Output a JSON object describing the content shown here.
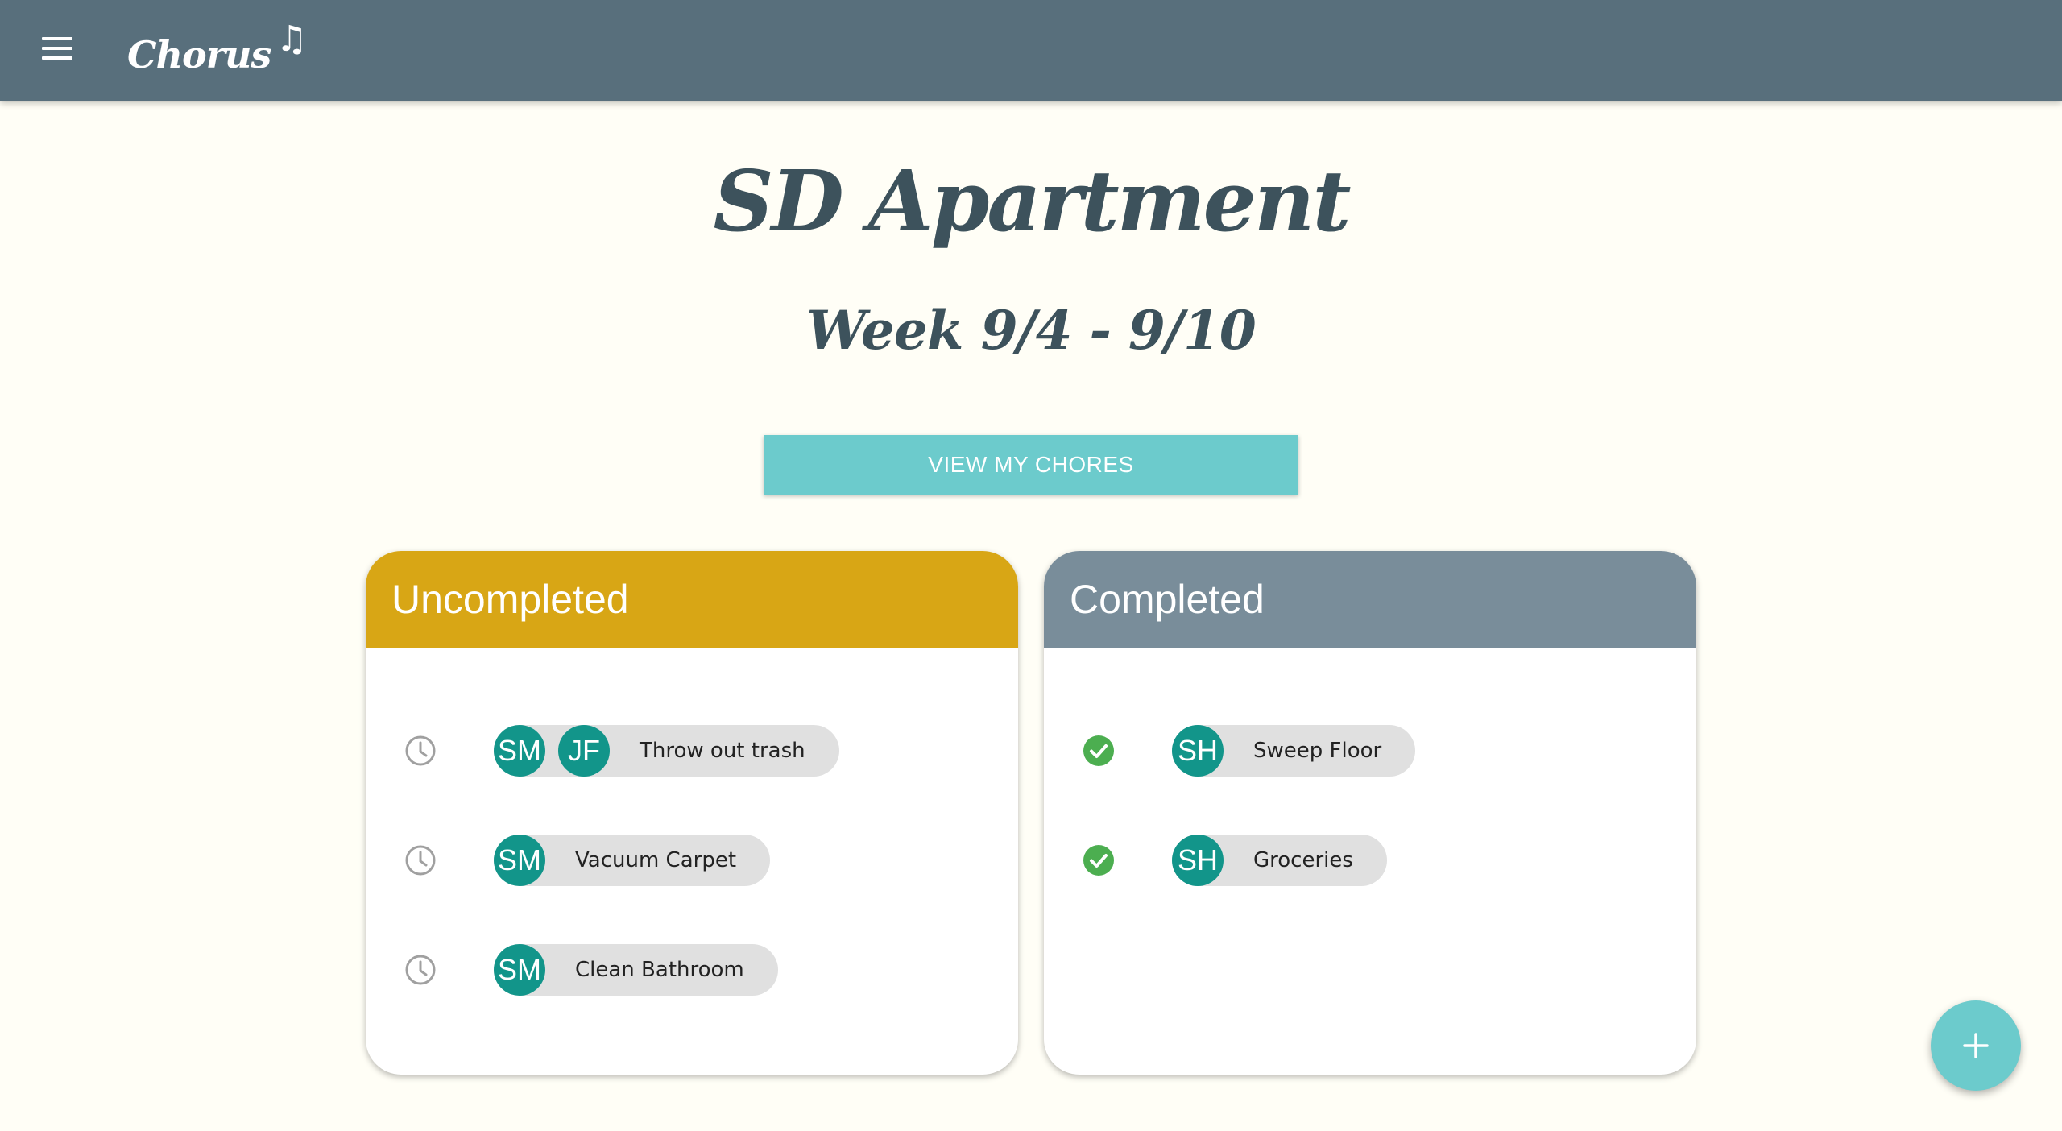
{
  "appbar": {
    "brand": "Chorus",
    "brand_glyph": "♫"
  },
  "page": {
    "title": "SD Apartment",
    "week": "Week 9/4 - 9/10",
    "view_button": "VIEW MY CHORES"
  },
  "uncompleted": {
    "header": "Uncompleted",
    "status_icon": "clock-icon",
    "items": [
      {
        "assignees": [
          "SM",
          "JF"
        ],
        "label": "Throw out trash"
      },
      {
        "assignees": [
          "SM"
        ],
        "label": "Vacuum Carpet"
      },
      {
        "assignees": [
          "SM"
        ],
        "label": "Clean Bathroom"
      }
    ]
  },
  "completed": {
    "header": "Completed",
    "status_icon": "check-circle-icon",
    "items": [
      {
        "assignees": [
          "SH"
        ],
        "label": "Sweep Floor"
      },
      {
        "assignees": [
          "SH"
        ],
        "label": "Groceries"
      }
    ]
  },
  "fab": {
    "icon": "plus-icon"
  },
  "colors": {
    "appbar": "#586f7c",
    "background": "#fffef6",
    "accent_teal": "#6ccbcc",
    "uncompleted_header": "#d8a615",
    "completed_header": "#798d9a",
    "avatar": "#12958a",
    "check_green": "#4cae50",
    "clock_gray": "#a0a0a0",
    "title_text": "#3d525c"
  }
}
